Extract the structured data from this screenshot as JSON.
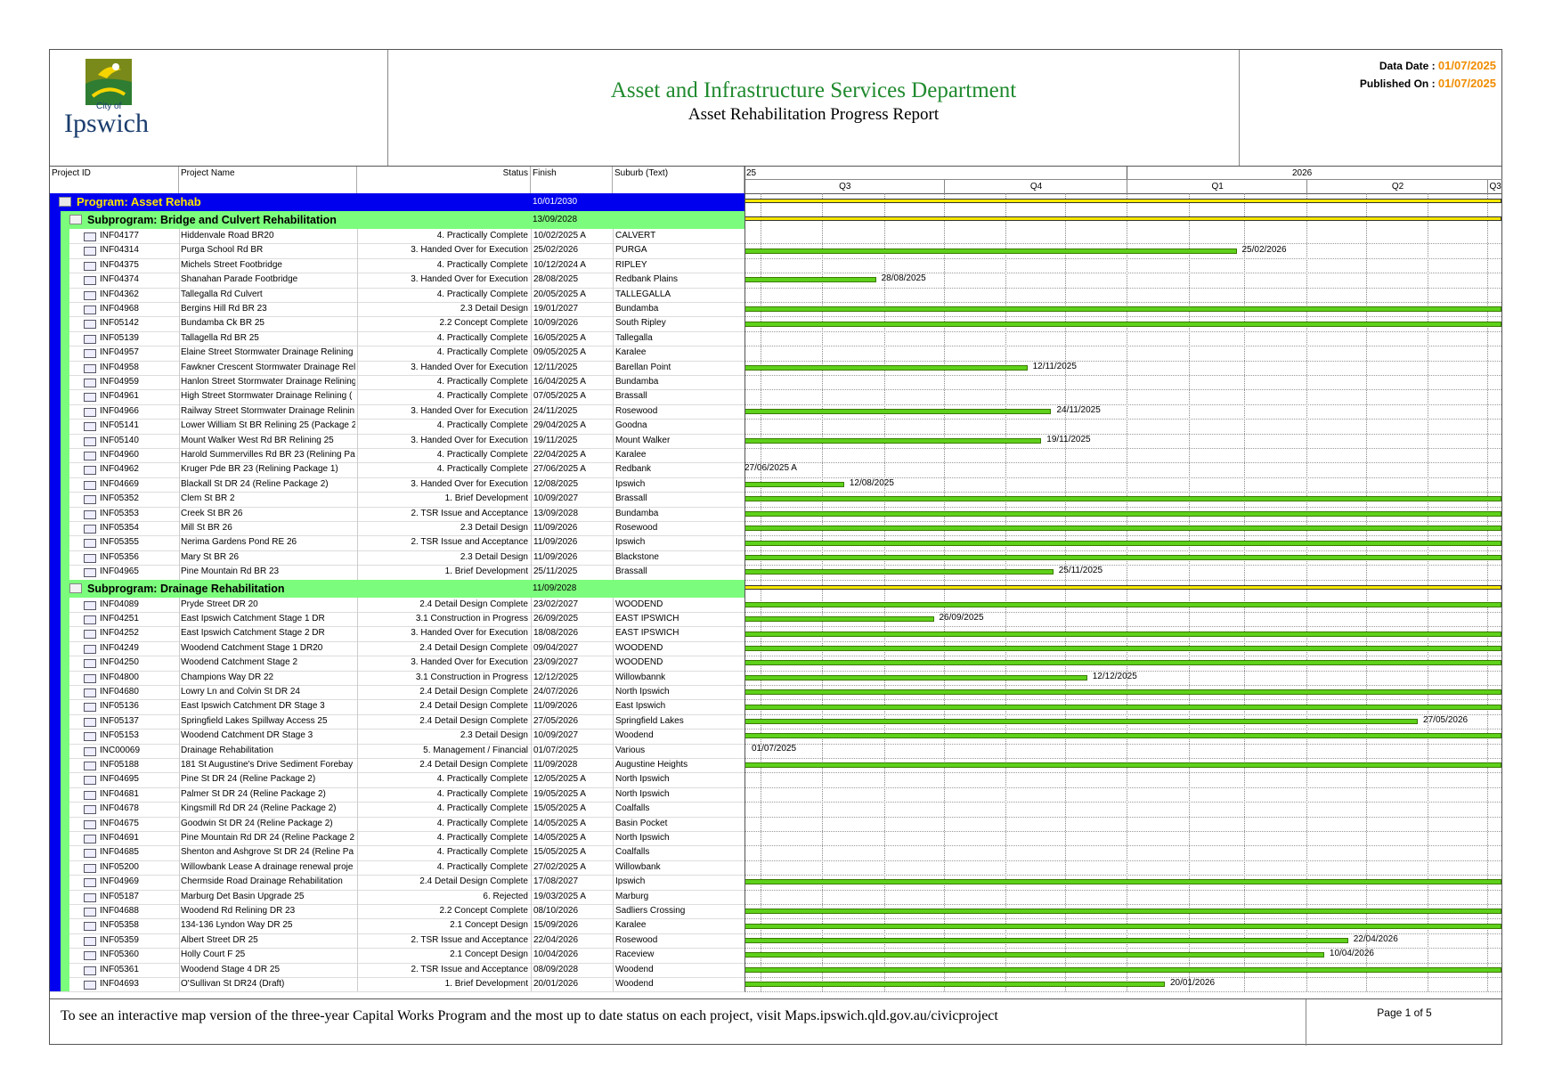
{
  "header": {
    "logo_text_small": "City of",
    "logo_text": "Ipswich",
    "title": "Asset and Infrastructure Services Department",
    "subtitle": "Asset Rehabilitation Progress Report",
    "data_date_label": "Data Date :",
    "data_date": "01/07/2025",
    "published_label": "Published On :",
    "published": "01/07/2025"
  },
  "columns": {
    "project_id": "Project ID",
    "project_name": "Project Name",
    "status": "Status",
    "finish": "Finish",
    "suburb": "Suburb (Text)"
  },
  "timeline": {
    "year_left": "25",
    "year_right": "2026",
    "quarters": [
      "Q3",
      "Q4",
      "Q1",
      "Q2",
      "Q3"
    ]
  },
  "program": {
    "label": "Program: Asset Rehab",
    "finish": "10/01/2030"
  },
  "subprograms": [
    {
      "label": "Subprogram: Bridge and Culvert Rehabilitation",
      "finish": "13/09/2028",
      "rows": [
        {
          "id": "INF04177",
          "name": "Hiddenvale Road BR20",
          "status": "4. Practically Complete",
          "finish": "10/02/2025 A",
          "suburb": "CALVERT"
        },
        {
          "id": "INF04314",
          "name": "Purga School Rd BR",
          "status": "3. Handed Over for Execution",
          "finish": "25/02/2026",
          "suburb": "PURGA"
        },
        {
          "id": "INF04375",
          "name": "Michels Street Footbridge",
          "status": "4. Practically Complete",
          "finish": "10/12/2024 A",
          "suburb": "RIPLEY"
        },
        {
          "id": "INF04374",
          "name": "Shanahan Parade Footbridge",
          "status": "3. Handed Over for Execution",
          "finish": "28/08/2025",
          "suburb": "Redbank Plains"
        },
        {
          "id": "INF04362",
          "name": "Tallegalla Rd Culvert",
          "status": "4. Practically Complete",
          "finish": "20/05/2025 A",
          "suburb": "TALLEGALLA"
        },
        {
          "id": "INF04968",
          "name": "Bergins Hill Rd BR 23",
          "status": "2.3 Detail Design",
          "finish": "19/01/2027",
          "suburb": "Bundamba"
        },
        {
          "id": "INF05142",
          "name": "Bundamba Ck BR 25",
          "status": "2.2 Concept Complete",
          "finish": "10/09/2026",
          "suburb": "South Ripley"
        },
        {
          "id": "INF05139",
          "name": "Tallagella Rd BR 25",
          "status": "4. Practically Complete",
          "finish": "16/05/2025 A",
          "suburb": "Tallegalla"
        },
        {
          "id": "INF04957",
          "name": "Elaine Street Stormwater Drainage Relining",
          "status": "4. Practically Complete",
          "finish": "09/05/2025 A",
          "suburb": "Karalee"
        },
        {
          "id": "INF04958",
          "name": "Fawkner Crescent Stormwater Drainage Reli",
          "status": "3. Handed Over for Execution",
          "finish": "12/11/2025",
          "suburb": "Barellan Point"
        },
        {
          "id": "INF04959",
          "name": "Hanlon Street Stormwater Drainage Relining",
          "status": "4. Practically Complete",
          "finish": "16/04/2025 A",
          "suburb": "Bundamba"
        },
        {
          "id": "INF04961",
          "name": "High Street Stormwater Drainage Relining (",
          "status": "4. Practically Complete",
          "finish": "07/05/2025 A",
          "suburb": "Brassall"
        },
        {
          "id": "INF04966",
          "name": "Railway Street Stormwater Drainage Relinin",
          "status": "3. Handed Over for Execution",
          "finish": "24/11/2025",
          "suburb": "Rosewood"
        },
        {
          "id": "INF05141",
          "name": "Lower William St BR Relining 25 (Package 2",
          "status": "4. Practically Complete",
          "finish": "29/04/2025 A",
          "suburb": "Goodna"
        },
        {
          "id": "INF05140",
          "name": "Mount Walker West Rd BR Relining 25",
          "status": "3. Handed Over for Execution",
          "finish": "19/11/2025",
          "suburb": "Mount Walker"
        },
        {
          "id": "INF04960",
          "name": "Harold Summervilles Rd BR 23 (Relining Pa",
          "status": "4. Practically Complete",
          "finish": "22/04/2025 A",
          "suburb": "Karalee"
        },
        {
          "id": "INF04962",
          "name": "Kruger Pde BR 23  (Relining Package 1)",
          "status": "4. Practically Complete",
          "finish": "27/06/2025 A",
          "suburb": "Redbank"
        },
        {
          "id": "INF04669",
          "name": "Blackall St DR 24 (Reline Package 2)",
          "status": "3. Handed Over for Execution",
          "finish": "12/08/2025",
          "suburb": "Ipswich"
        },
        {
          "id": "INF05352",
          "name": "Clem St BR 2",
          "status": "1. Brief Development",
          "finish": "10/09/2027",
          "suburb": "Brassall"
        },
        {
          "id": "INF05353",
          "name": "Creek St BR 26",
          "status": "2. TSR Issue and Acceptance",
          "finish": "13/09/2028",
          "suburb": "Bundamba"
        },
        {
          "id": "INF05354",
          "name": "Mill St BR 26",
          "status": "2.3 Detail Design",
          "finish": "11/09/2026",
          "suburb": "Rosewood"
        },
        {
          "id": "INF05355",
          "name": "Nerima Gardens Pond RE 26",
          "status": "2. TSR Issue and Acceptance",
          "finish": "11/09/2026",
          "suburb": "Ipswich"
        },
        {
          "id": "INF05356",
          "name": "Mary St BR 26",
          "status": "2.3 Detail Design",
          "finish": "11/09/2026",
          "suburb": "Blackstone"
        },
        {
          "id": "INF04965",
          "name": "Pine Mountain Rd BR 23",
          "status": "1. Brief Development",
          "finish": "25/11/2025",
          "suburb": "Brassall"
        }
      ]
    },
    {
      "label": "Subprogram: Drainage Rehabilitation",
      "finish": "11/09/2028",
      "rows": [
        {
          "id": "INF04089",
          "name": "Pryde Street DR 20",
          "status": "2.4 Detail Design Complete",
          "finish": "23/02/2027",
          "suburb": "WOODEND"
        },
        {
          "id": "INF04251",
          "name": "East Ipswich Catchment Stage 1 DR",
          "status": "3.1 Construction in Progress",
          "finish": "26/09/2025",
          "suburb": "EAST IPSWICH"
        },
        {
          "id": "INF04252",
          "name": "East Ipswich Catchment Stage 2 DR",
          "status": "3. Handed Over for Execution",
          "finish": "18/08/2026",
          "suburb": "EAST IPSWICH"
        },
        {
          "id": "INF04249",
          "name": "Woodend Catchment Stage 1 DR20",
          "status": "2.4 Detail Design Complete",
          "finish": "09/04/2027",
          "suburb": "WOODEND"
        },
        {
          "id": "INF04250",
          "name": "Woodend Catchment Stage 2",
          "status": "3. Handed Over for Execution",
          "finish": "23/09/2027",
          "suburb": "WOODEND"
        },
        {
          "id": "INF04800",
          "name": "Champions Way DR 22",
          "status": "3.1 Construction in Progress",
          "finish": "12/12/2025",
          "suburb": "Willowbannk"
        },
        {
          "id": "INF04680",
          "name": "Lowry Ln and Colvin St DR 24",
          "status": "2.4 Detail Design Complete",
          "finish": "24/07/2026",
          "suburb": "North Ipswich"
        },
        {
          "id": "INF05136",
          "name": "East Ipswich Catchment DR Stage 3",
          "status": "2.4 Detail Design Complete",
          "finish": "11/09/2026",
          "suburb": "East Ipswich"
        },
        {
          "id": "INF05137",
          "name": "Springfield Lakes Spillway Access 25",
          "status": "2.4 Detail Design Complete",
          "finish": "27/05/2026",
          "suburb": "Springfield Lakes"
        },
        {
          "id": "INF05153",
          "name": "Woodend Catchment DR Stage 3",
          "status": "2.3 Detail Design",
          "finish": "10/09/2027",
          "suburb": "Woodend"
        },
        {
          "id": "INC00069",
          "name": "Drainage Rehabilitation",
          "status": "5. Management / Financial",
          "finish": "01/07/2025",
          "suburb": "Various"
        },
        {
          "id": "INF05188",
          "name": "181 St Augustine's Drive Sediment Forebay",
          "status": "2.4 Detail Design Complete",
          "finish": "11/09/2028",
          "suburb": "Augustine Heights"
        },
        {
          "id": "INF04695",
          "name": "Pine St DR 24 (Reline Package 2)",
          "status": "4. Practically Complete",
          "finish": "12/05/2025 A",
          "suburb": "North Ipswich"
        },
        {
          "id": "INF04681",
          "name": "Palmer St DR 24 (Reline Package 2)",
          "status": "4. Practically Complete",
          "finish": "19/05/2025 A",
          "suburb": "North Ipswich"
        },
        {
          "id": "INF04678",
          "name": "Kingsmill Rd DR 24 (Reline Package 2)",
          "status": "4. Practically Complete",
          "finish": "15/05/2025 A",
          "suburb": "Coalfalls"
        },
        {
          "id": "INF04675",
          "name": "Goodwin St DR 24 (Reline Package 2)",
          "status": "4. Practically Complete",
          "finish": "14/05/2025 A",
          "suburb": "Basin Pocket"
        },
        {
          "id": "INF04691",
          "name": "Pine Mountain Rd DR 24 (Reline Package 2",
          "status": "4. Practically Complete",
          "finish": "14/05/2025 A",
          "suburb": "North Ipswich"
        },
        {
          "id": "INF04685",
          "name": "Shenton and Ashgrove St DR 24 (Reline Pa",
          "status": "4. Practically Complete",
          "finish": "15/05/2025 A",
          "suburb": "Coalfalls"
        },
        {
          "id": "INF05200",
          "name": "Willowbank Lease A drainage renewal proje",
          "status": "4. Practically Complete",
          "finish": "27/02/2025 A",
          "suburb": "Willowbank"
        },
        {
          "id": "INF04969",
          "name": "Chermside Road Drainage Rehabilitation",
          "status": "2.4 Detail Design Complete",
          "finish": "17/08/2027",
          "suburb": "Ipswich"
        },
        {
          "id": "INF05187",
          "name": "Marburg Det Basin Upgrade 25",
          "status": "6. Rejected",
          "finish": "19/03/2025 A",
          "suburb": "Marburg"
        },
        {
          "id": "INF04688",
          "name": "Woodend Rd Relining DR 23",
          "status": "2.2 Concept Complete",
          "finish": "08/10/2026",
          "suburb": "Sadliers Crossing"
        },
        {
          "id": "INF05358",
          "name": "134-136 Lyndon Way DR 25",
          "status": "2.1 Concept Design",
          "finish": "15/09/2026",
          "suburb": "Karalee"
        },
        {
          "id": "INF05359",
          "name": "Albert Street DR 25",
          "status": "2. TSR Issue and Acceptance",
          "finish": "22/04/2026",
          "suburb": "Rosewood"
        },
        {
          "id": "INF05360",
          "name": "Holly Court F 25",
          "status": "2.1 Concept Design",
          "finish": "10/04/2026",
          "suburb": "Raceview"
        },
        {
          "id": "INF05361",
          "name": "Woodend Stage 4 DR 25",
          "status": "2. TSR Issue and Acceptance",
          "finish": "08/09/2028",
          "suburb": "Woodend"
        },
        {
          "id": "INF04693",
          "name": "O'Sullivan St DR24 (Draft)",
          "status": "1. Brief Development",
          "finish": "20/01/2026",
          "suburb": "Woodend"
        }
      ]
    }
  ],
  "footer": {
    "text": "To see an interactive map version of the three-year Capital Works Program and the most up to date status on each project, visit Maps.ipswich.qld.gov.au/civicproject",
    "page": "Page 1 of 5"
  },
  "colors": {
    "title": "#1f8a2e",
    "program_bg": "#0000ee",
    "program_text": "#ffe600",
    "subprogram_bg": "#7cfc7c",
    "bar": "#5ed11a",
    "date_accent": "#f08c00"
  }
}
